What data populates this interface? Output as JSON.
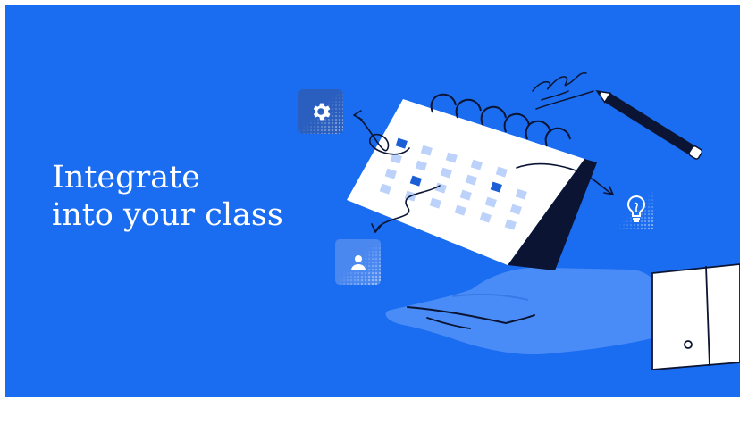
{
  "headline": {
    "line1": "Integrate",
    "line2": "into your class"
  },
  "colors": {
    "background": "#1a6cf0",
    "hand": "#4a8cf7",
    "calendar_page": "#ffffff",
    "calendar_day": "#bcd2fa",
    "calendar_day_highlight": "#1b5fd6",
    "ink": "#0b1533"
  },
  "icons": [
    "gear-icon",
    "user-icon",
    "lightbulb-icon",
    "pencil-icon",
    "calendar-icon",
    "hand-icon"
  ]
}
